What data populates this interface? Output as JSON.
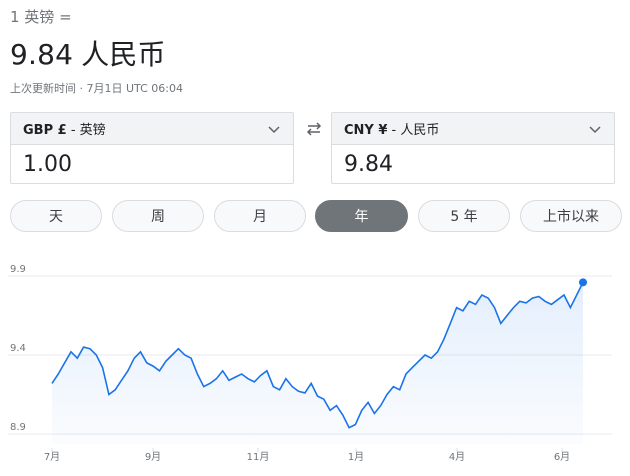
{
  "header": {
    "from_text": "1 英镑 =",
    "result_value": "9.84",
    "result_currency": "人民币",
    "timestamp": "上次更新时间 · 7月1日 UTC 06:04"
  },
  "converter": {
    "from": {
      "code_label": "GBP £",
      "name_label": "- 英镑",
      "amount": "1.00"
    },
    "to": {
      "code_label": "CNY ¥",
      "name_label": "- 人民币",
      "amount": "9.84"
    }
  },
  "tabs": [
    {
      "label": "天",
      "active": false
    },
    {
      "label": "周",
      "active": false
    },
    {
      "label": "月",
      "active": false
    },
    {
      "label": "年",
      "active": true
    },
    {
      "label": "5 年",
      "active": false
    },
    {
      "label": "上市以来",
      "active": false
    }
  ],
  "chart_data": {
    "type": "line",
    "y_ticks": [
      "9.9",
      "9.4",
      "8.9"
    ],
    "ylim": [
      8.9,
      9.9
    ],
    "x_ticks": [
      "7月",
      "9月",
      "11月",
      "1月",
      "4月",
      "6月"
    ],
    "series": [
      {
        "color": "#1a73e8",
        "values": [
          9.22,
          9.28,
          9.35,
          9.42,
          9.38,
          9.45,
          9.44,
          9.4,
          9.32,
          9.15,
          9.18,
          9.24,
          9.3,
          9.38,
          9.42,
          9.35,
          9.33,
          9.3,
          9.36,
          9.4,
          9.44,
          9.4,
          9.38,
          9.28,
          9.2,
          9.22,
          9.25,
          9.3,
          9.24,
          9.26,
          9.28,
          9.25,
          9.23,
          9.27,
          9.3,
          9.2,
          9.18,
          9.25,
          9.2,
          9.17,
          9.16,
          9.22,
          9.14,
          9.12,
          9.05,
          9.08,
          9.02,
          8.94,
          8.96,
          9.05,
          9.1,
          9.03,
          9.08,
          9.15,
          9.2,
          9.18,
          9.28,
          9.32,
          9.36,
          9.4,
          9.38,
          9.42,
          9.5,
          9.6,
          9.7,
          9.68,
          9.74,
          9.72,
          9.78,
          9.76,
          9.7,
          9.6,
          9.65,
          9.7,
          9.74,
          9.73,
          9.76,
          9.77,
          9.74,
          9.72,
          9.75,
          9.78,
          9.7,
          9.78,
          9.86
        ]
      }
    ]
  }
}
